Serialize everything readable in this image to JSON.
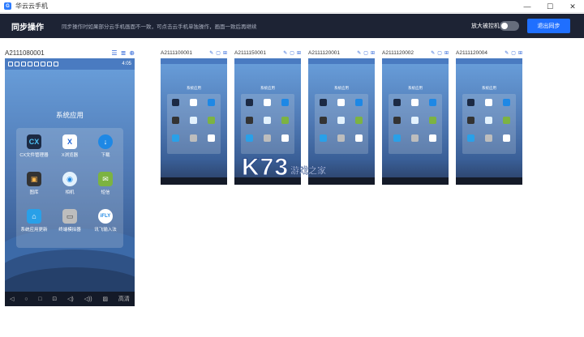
{
  "window": {
    "title": "华云云手机",
    "logo": "G"
  },
  "header": {
    "title": "同步操作",
    "tip": "同步操作时如果部分云手机画面不一致，可点击云手机单独操作，画面一致后再继续",
    "zoom_label": "放大被控机",
    "exit_label": "退出同步"
  },
  "main_phone": {
    "id": "A2111080001",
    "time": "4:05",
    "folder_title": "系统应用",
    "apps": [
      {
        "label": "CX文件管理器",
        "glyph": "CX",
        "color": "#1c2a44"
      },
      {
        "label": "X浏览器",
        "glyph": "X",
        "color": "#ffffff"
      },
      {
        "label": "下载",
        "glyph": "↓",
        "color": "#1e88e5"
      },
      {
        "label": "图库",
        "glyph": "▣",
        "color": "#333333"
      },
      {
        "label": "相机",
        "glyph": "◉",
        "color": "#e3f2fd"
      },
      {
        "label": "短信",
        "glyph": "✉",
        "color": "#7cb342"
      },
      {
        "label": "系统应用更新",
        "glyph": "⌂",
        "color": "#29a0e8"
      },
      {
        "label": "终端模拟器",
        "glyph": "▭",
        "color": "#bdbdbd"
      },
      {
        "label": "讯飞输入法",
        "glyph": "iFLY",
        "color": "#ffffff"
      }
    ],
    "quality": "高清"
  },
  "thumbs": [
    {
      "id": "A2111100001"
    },
    {
      "id": "A2111150001"
    },
    {
      "id": "A2111120001"
    },
    {
      "id": "A2111120002"
    },
    {
      "id": "A2111120004"
    }
  ],
  "watermark": {
    "brand": "K73",
    "sub": "游戏之家"
  }
}
